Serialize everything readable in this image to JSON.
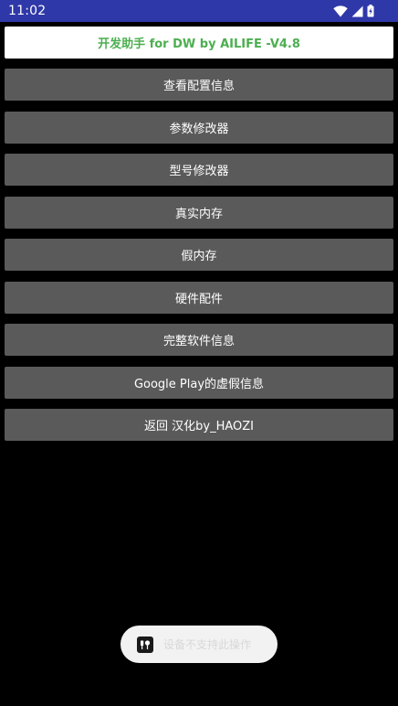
{
  "status_bar": {
    "time": "11:02",
    "background": "#2f38a8",
    "icons": [
      "wifi-icon",
      "signal-icon",
      "battery-charging-icon"
    ]
  },
  "title_banner": {
    "text": "开发助手 for DW by AILIFE -V4.8",
    "text_color": "#4caf50"
  },
  "menu": {
    "button_color": "#5a5a5a",
    "items": [
      {
        "label": "查看配置信息"
      },
      {
        "label": "参数修改器"
      },
      {
        "label": "型号修改器"
      },
      {
        "label": "真实内存"
      },
      {
        "label": "假内存"
      },
      {
        "label": "硬件配件"
      },
      {
        "label": "完整软件信息"
      },
      {
        "label": "Google Play的虚假信息"
      },
      {
        "label": "返回 汉化by_HAOZI"
      }
    ]
  },
  "toast": {
    "icon": "app-icon",
    "text": "设备不支持此操作"
  }
}
